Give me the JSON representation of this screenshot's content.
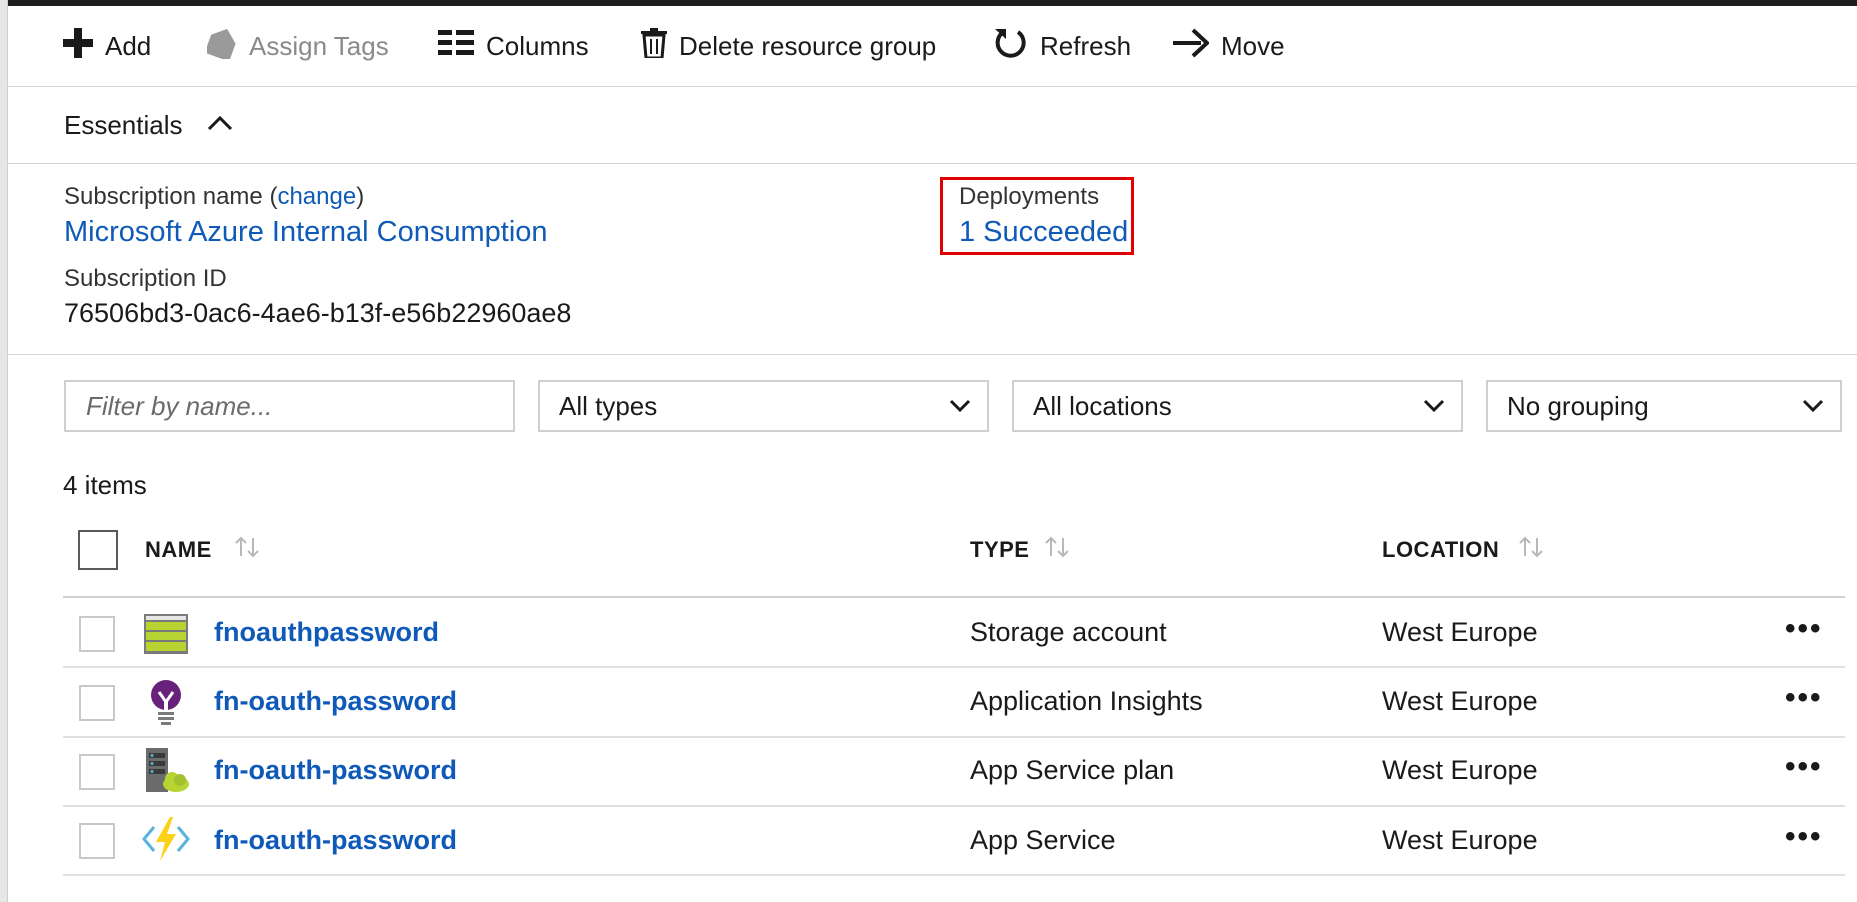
{
  "toolbar": {
    "add": "Add",
    "assign_tags": "Assign Tags",
    "columns": "Columns",
    "delete_group": "Delete resource group",
    "refresh": "Refresh",
    "move": "Move"
  },
  "essentials": {
    "title": "Essentials",
    "subscription_name_label": "Subscription name",
    "change_link": "change",
    "subscription_name": "Microsoft Azure Internal Consumption",
    "subscription_id_label": "Subscription ID",
    "subscription_id": "76506bd3-0ac6-4ae6-b13f-e56b22960ae8",
    "deployments_label": "Deployments",
    "deployments_value": "1 Succeeded"
  },
  "filters": {
    "name_placeholder": "Filter by name...",
    "types": "All types",
    "locations": "All locations",
    "grouping": "No grouping"
  },
  "count": "4 items",
  "table": {
    "columns": [
      "NAME",
      "TYPE",
      "LOCATION"
    ],
    "rows": [
      {
        "name": "fnoauthpassword",
        "type": "Storage account",
        "location": "West Europe",
        "icon": "storage-account-icon"
      },
      {
        "name": "fn-oauth-password",
        "type": "Application Insights",
        "location": "West Europe",
        "icon": "application-insights-icon"
      },
      {
        "name": "fn-oauth-password",
        "type": "App Service plan",
        "location": "West Europe",
        "icon": "app-service-plan-icon"
      },
      {
        "name": "fn-oauth-password",
        "type": "App Service",
        "location": "West Europe",
        "icon": "function-app-icon"
      }
    ],
    "more": "•••"
  },
  "colors": {
    "link": "#0f5ab8",
    "highlight": "#e00000"
  }
}
